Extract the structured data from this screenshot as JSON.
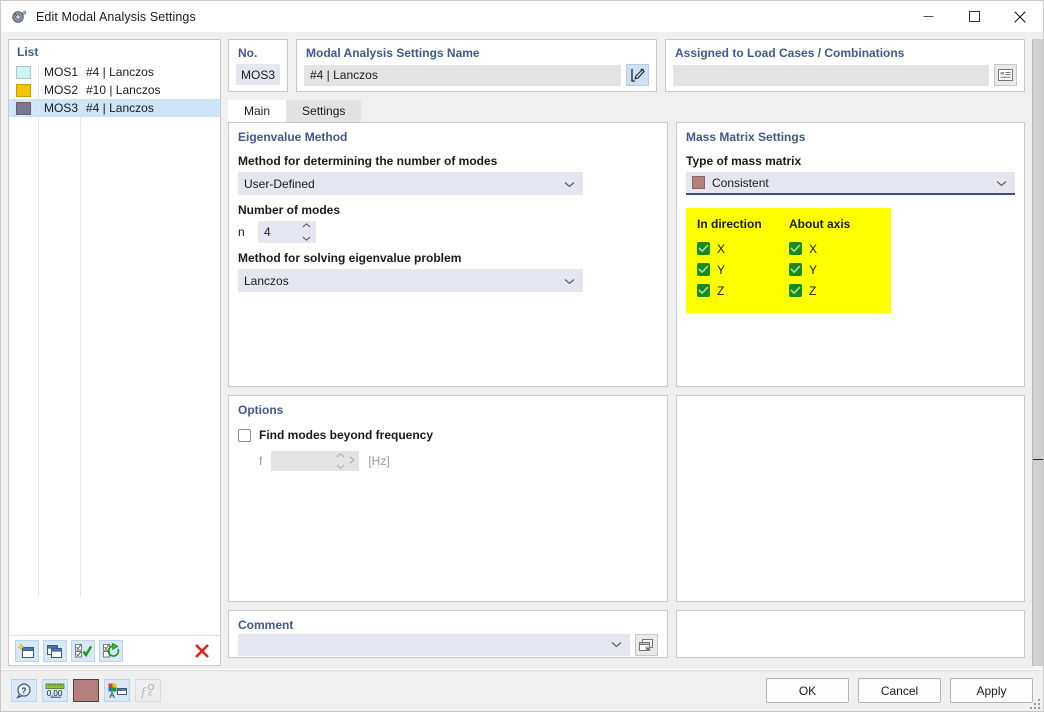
{
  "window": {
    "title": "Edit Modal Analysis Settings",
    "icon": "modal-analysis-icon",
    "minimize": "—",
    "maximize": "☐",
    "close": "✕"
  },
  "list_panel": {
    "header": "List",
    "rows": [
      {
        "color": "#cdf5f5",
        "no": "MOS1",
        "desc": "#4 | Lanczos",
        "selected": false
      },
      {
        "color": "#f5c400",
        "no": "MOS2",
        "desc": "#10 | Lanczos",
        "selected": false
      },
      {
        "color": "#7d7591",
        "no": "MOS3",
        "desc": "#4 | Lanczos",
        "selected": true
      }
    ],
    "toolbar": [
      {
        "name": "new-item-button",
        "glyph": "new"
      },
      {
        "name": "copy-item-button",
        "glyph": "copy"
      },
      {
        "name": "select-all-button",
        "glyph": "check"
      },
      {
        "name": "refresh-selection-button",
        "glyph": "refresh"
      },
      {
        "name": "delete-item-button",
        "glyph": "delete"
      }
    ]
  },
  "header": {
    "no_label": "No.",
    "no_value": "MOS3",
    "name_label": "Modal Analysis Settings Name",
    "name_value": "#4 | Lanczos",
    "name_edit_icon": "edit-pencil-icon",
    "assigned_label": "Assigned to Load Cases / Combinations",
    "assigned_value": "",
    "assigned_icon": "list-selection-icon"
  },
  "tabs": [
    {
      "label": "Main",
      "active": true
    },
    {
      "label": "Settings",
      "active": false
    }
  ],
  "eigenvalue_method": {
    "title": "Eigenvalue Method",
    "method_modes_label": "Method for determining the number of modes",
    "method_modes_value": "User-Defined",
    "number_of_modes_label": "Number of modes",
    "n_symbol": "n",
    "n_value": "4",
    "solver_label": "Method for solving eigenvalue problem",
    "solver_value": "Lanczos"
  },
  "mass_matrix": {
    "title": "Mass Matrix Settings",
    "type_label": "Type of mass matrix",
    "type_value": "Consistent",
    "type_swatch": "#b57f7f",
    "highlight_color": "#ffff00",
    "in_direction_label": "In direction",
    "about_axis_label": "About axis",
    "in_direction": [
      {
        "label": "X",
        "checked": true
      },
      {
        "label": "Y",
        "checked": true
      },
      {
        "label": "Z",
        "checked": true
      }
    ],
    "about_axis": [
      {
        "label": "X",
        "checked": true
      },
      {
        "label": "Y",
        "checked": true
      },
      {
        "label": "Z",
        "checked": true
      }
    ]
  },
  "options": {
    "title": "Options",
    "find_modes_label": "Find modes beyond frequency",
    "find_modes_checked": false,
    "f_symbol": "f",
    "f_value": "",
    "f_unit": "[Hz]"
  },
  "comment": {
    "title": "Comment",
    "value": "",
    "icon": "comment-pick-icon"
  },
  "footer": {
    "tools": [
      {
        "name": "help-button",
        "glyph": "help"
      },
      {
        "name": "units-button",
        "glyph": "units"
      },
      {
        "name": "color-button",
        "glyph": "color",
        "color": "#b57f7f"
      },
      {
        "name": "display-properties-button",
        "glyph": "display"
      },
      {
        "name": "formula-button",
        "glyph": "formula",
        "disabled": true
      }
    ],
    "ok": "OK",
    "cancel": "Cancel",
    "apply": "Apply"
  }
}
